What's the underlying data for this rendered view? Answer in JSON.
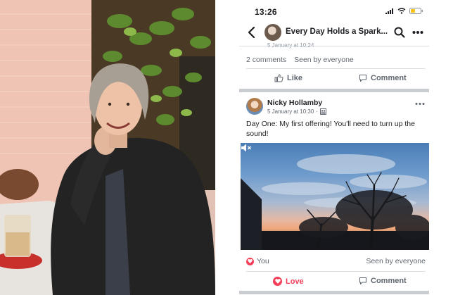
{
  "status_bar": {
    "time": "13:26"
  },
  "group": {
    "title": "Every Day Holds a Spark..."
  },
  "previous_post": {
    "meta_cut": "5 January at 10:24",
    "comments": "2 comments",
    "seen": "Seen by everyone",
    "like_label": "Like",
    "comment_label": "Comment"
  },
  "post": {
    "author": "Nicky Hollamby",
    "time": "5 January at 10:30",
    "text": "Day One: My first offering!  You'll need to turn up the sound!",
    "reaction_text": "You",
    "seen": "Seen by everyone",
    "love_label": "Love",
    "comment_label": "Comment"
  },
  "colors": {
    "love": "#f33e58",
    "action_grey": "#606770",
    "divider": "#dadde1"
  },
  "icons": [
    "back-icon",
    "search-icon",
    "more-icon",
    "like-icon",
    "comment-icon",
    "love-icon",
    "mute-icon",
    "members-icon",
    "signal-icon",
    "wifi-icon",
    "battery-icon"
  ]
}
